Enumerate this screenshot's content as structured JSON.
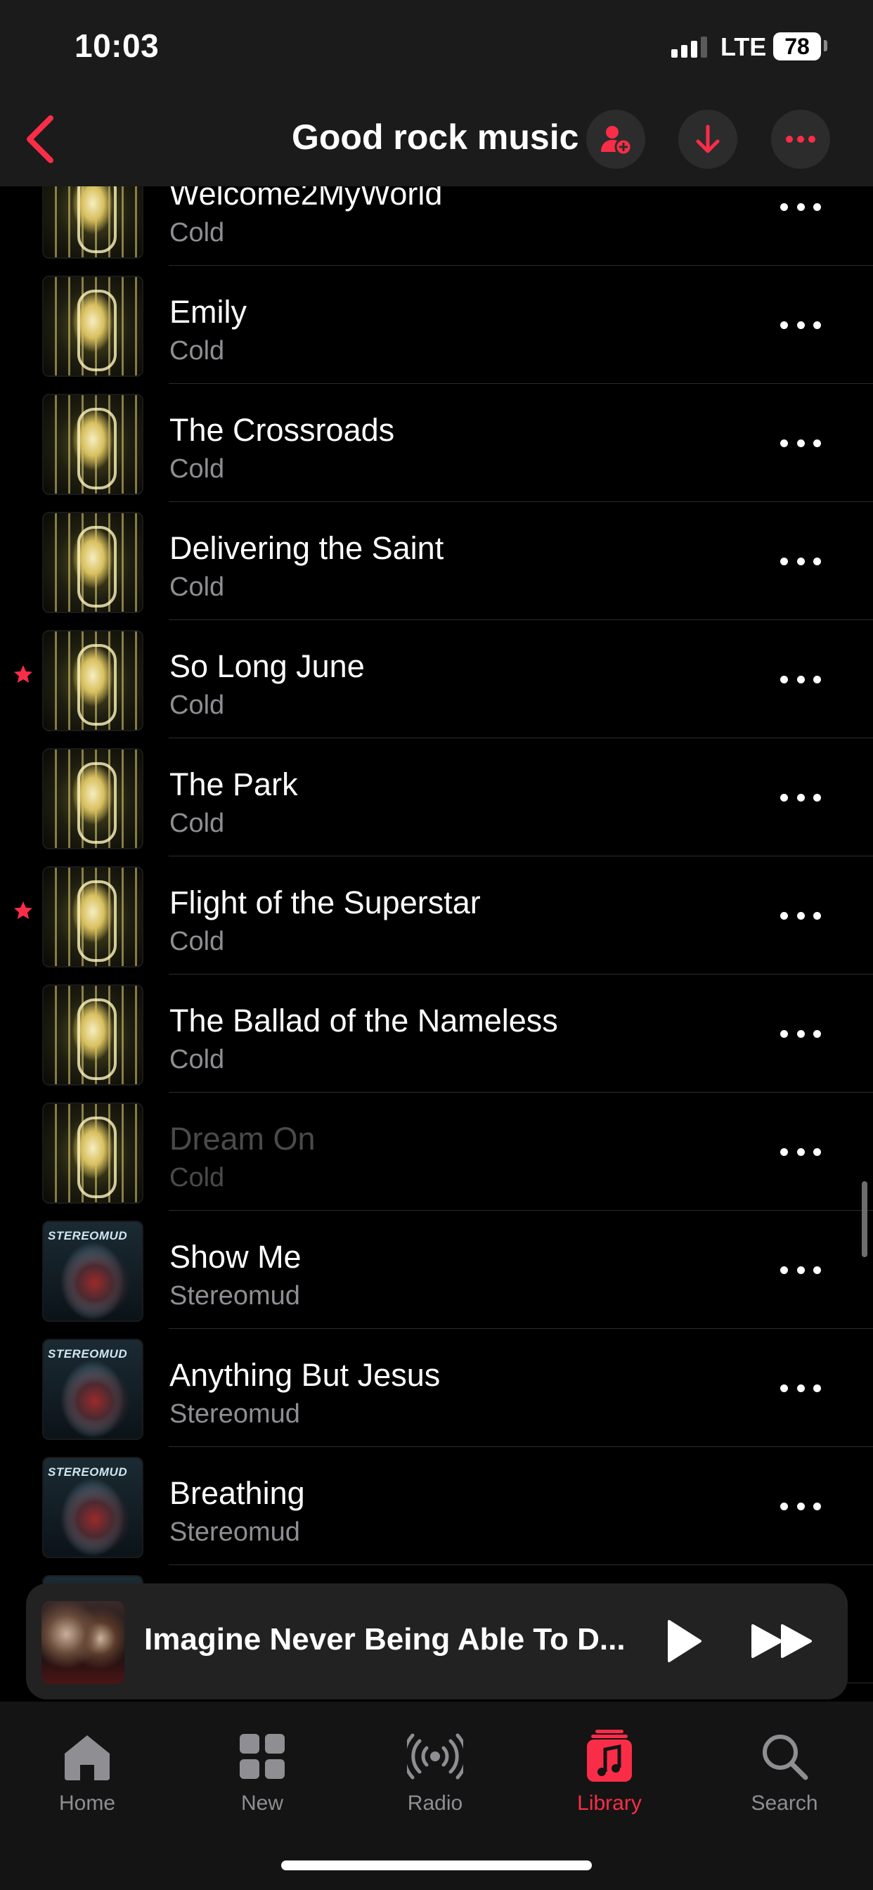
{
  "status_bar": {
    "time": "10:03",
    "network": "LTE",
    "battery": "78"
  },
  "nav": {
    "title": "Good rock music",
    "accent": "#fa2d48"
  },
  "tracks": [
    {
      "title": "Welcome2MyWorld",
      "artist": "Cold",
      "art": "cold-cover",
      "starred": false,
      "dimmed": false
    },
    {
      "title": "Emily",
      "artist": "Cold",
      "art": "cold-cover",
      "starred": false,
      "dimmed": false
    },
    {
      "title": "The Crossroads",
      "artist": "Cold",
      "art": "cold-cover",
      "starred": false,
      "dimmed": false
    },
    {
      "title": "Delivering the Saint",
      "artist": "Cold",
      "art": "cold-cover",
      "starred": false,
      "dimmed": false
    },
    {
      "title": "So Long June",
      "artist": "Cold",
      "art": "cold-cover",
      "starred": true,
      "dimmed": false
    },
    {
      "title": "The Park",
      "artist": "Cold",
      "art": "cold-cover",
      "starred": false,
      "dimmed": false
    },
    {
      "title": "Flight of the Superstar",
      "artist": "Cold",
      "art": "cold-cover",
      "starred": true,
      "dimmed": false
    },
    {
      "title": "The Ballad of the Nameless",
      "artist": "Cold",
      "art": "cold-cover",
      "starred": false,
      "dimmed": false
    },
    {
      "title": "Dream On",
      "artist": "Cold",
      "art": "cold-cover",
      "starred": false,
      "dimmed": true
    },
    {
      "title": "Show Me",
      "artist": "Stereomud",
      "art": "stereomud-cover",
      "starred": false,
      "dimmed": false
    },
    {
      "title": "Anything But Jesus",
      "artist": "Stereomud",
      "art": "stereomud-cover",
      "starred": false,
      "dimmed": false
    },
    {
      "title": "Breathing",
      "artist": "Stereomud",
      "art": "stereomud-cover",
      "starred": false,
      "dimmed": false
    },
    {
      "title": "",
      "artist": "",
      "art": "stereomud-cover",
      "starred": false,
      "dimmed": false
    }
  ],
  "album_art_text": {
    "stereomud": "STEREOMUD"
  },
  "mini_player": {
    "title": "Imagine Never Being Able To D..."
  },
  "tabs": [
    {
      "label": "Home",
      "icon": "house-icon",
      "active": false
    },
    {
      "label": "New",
      "icon": "grid-icon",
      "active": false
    },
    {
      "label": "Radio",
      "icon": "radio-waves-icon",
      "active": false
    },
    {
      "label": "Library",
      "icon": "music-note-icon",
      "active": true
    },
    {
      "label": "Search",
      "icon": "magnifier-icon",
      "active": false
    }
  ]
}
